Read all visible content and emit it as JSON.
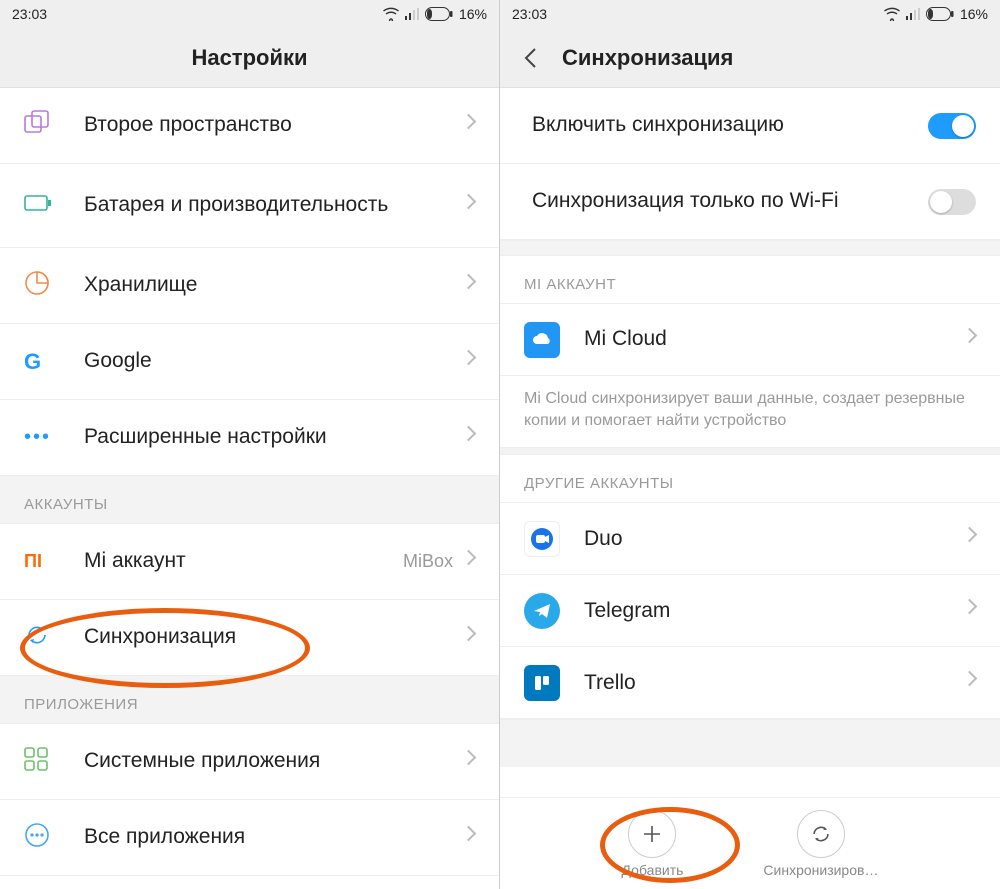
{
  "status": {
    "time": "23:03",
    "battery": "16%"
  },
  "left": {
    "title": "Настройки",
    "rows": {
      "second_space": "Второе пространство",
      "battery_perf": "Батарея и производительность",
      "storage": "Хранилище",
      "google": "Google",
      "advanced": "Расширенные настройки"
    },
    "section_accounts": "АККАУНТЫ",
    "mi_account_label": "Mi аккаунт",
    "mi_account_value": "MiBox",
    "sync_label": "Синхронизация",
    "section_apps": "ПРИЛОЖЕНИЯ",
    "system_apps": "Системные приложения",
    "all_apps": "Все приложения"
  },
  "right": {
    "title": "Синхронизация",
    "enable_sync": "Включить синхронизацию",
    "wifi_only": "Синхронизация только по Wi-Fi",
    "section_mi": "MI АККАУНТ",
    "mi_cloud": "Mi Cloud",
    "mi_cloud_desc": "Mi Cloud синхронизирует ваши данные, создает резервные копии и помогает найти устройство",
    "section_other": "ДРУГИЕ АККАУНТЫ",
    "duo": "Duo",
    "telegram": "Telegram",
    "trello": "Trello",
    "add_label": "Добавить",
    "sync_now_label": "Синхронизиров…"
  }
}
